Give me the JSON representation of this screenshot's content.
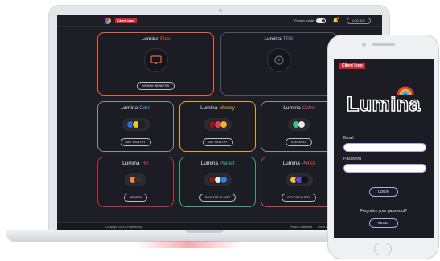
{
  "laptop": {
    "topbar": {
      "client_logo": "Client logo",
      "privacy_mode": "Privacy mode",
      "logout": "LOG OUT"
    },
    "cards": [
      {
        "brand": "Lumina",
        "name": "Flex",
        "accent": "#e8633a",
        "border": "#e8633a",
        "button": "VIEW MY BENEFITS"
      },
      {
        "brand": "Lumina",
        "name": "TRS",
        "accent": "#8a88a6",
        "border": "#5a5a6a",
        "button": ""
      },
      {
        "brand": "Lumina",
        "name": "Care",
        "accent": "#4fb3ff",
        "border": "#8f8f99",
        "button": "GET HEALTHY"
      },
      {
        "brand": "Lumina",
        "name": "Money",
        "accent": "#f0b33a",
        "border": "#e0a830",
        "button": "GET HEALTHY"
      },
      {
        "brand": "Lumina",
        "name": "Calm",
        "accent": "#e05555",
        "border": "#8f8f99",
        "button": "STAY WELL"
      },
      {
        "brand": "Lumina",
        "name": "HR",
        "accent": "#e03c3c",
        "border": "#c02f3a",
        "button": "HR APPS"
      },
      {
        "brand": "Lumina",
        "name": "Planet",
        "accent": "#3dbf7a",
        "border": "#3aaa6e",
        "button": "SAVE THE PLANET"
      },
      {
        "brand": "Lumina",
        "name": "Perks",
        "accent": "#e86b3a",
        "border": "#c94444",
        "button": "GET DISCOUNTS"
      }
    ],
    "footer": {
      "left": "Copyright 2021 | Powered by",
      "right_1": "Privacy Statement",
      "right_2": "Terms of Use"
    }
  },
  "phone": {
    "client_logo": "Client logo",
    "logo_text": "Lumina",
    "email_label": "Email",
    "password_label": "Password",
    "login_button": "LOGIN",
    "forgot_text": "Forgotten your password?",
    "reset_button": "RESET"
  },
  "colors": {
    "screen_bg": "#1e1f26",
    "client_logo_bg": "#d91e2c",
    "input_border": "#b7a3e6"
  }
}
